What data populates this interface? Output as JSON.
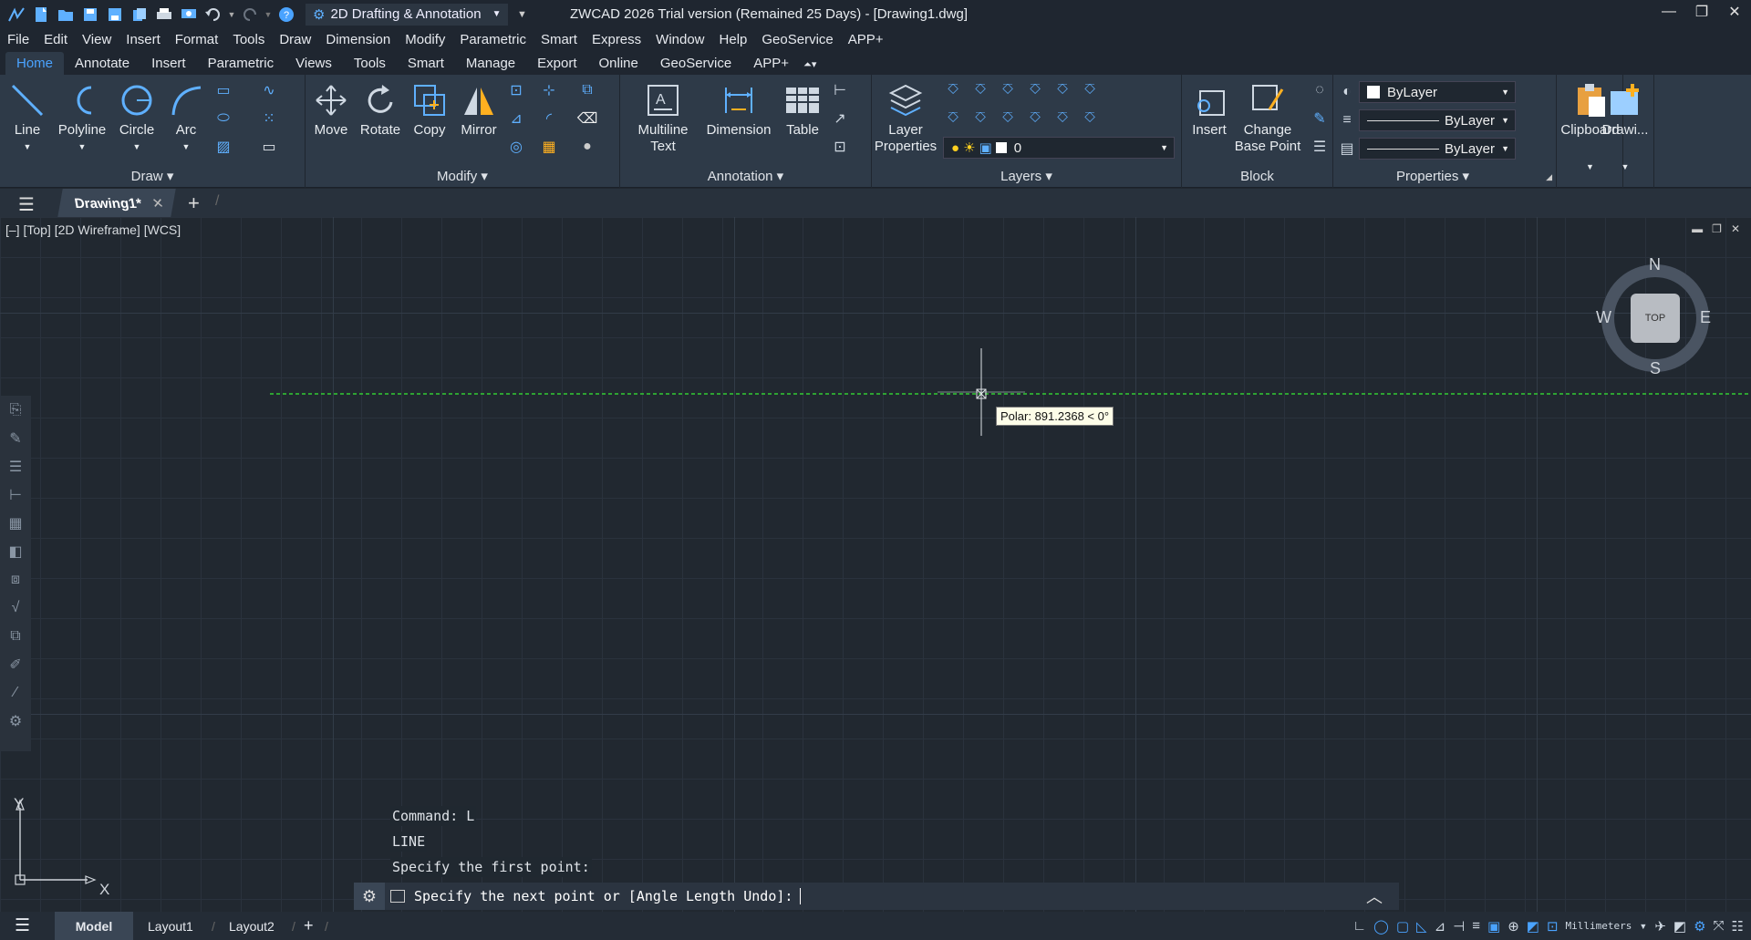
{
  "titlebar": {
    "workspace": "2D Drafting & Annotation",
    "title": "ZWCAD 2026 Trial version (Remained 25 Days) - [Drawing1.dwg]",
    "quick_access_icons": [
      "app-logo-icon",
      "new-icon",
      "open-icon",
      "save-icon",
      "save-as-icon",
      "publish-icon",
      "print-icon",
      "preview-icon",
      "undo-icon",
      "redo-icon",
      "help-icon"
    ]
  },
  "menu": [
    "File",
    "Edit",
    "View",
    "Insert",
    "Format",
    "Tools",
    "Draw",
    "Dimension",
    "Modify",
    "Parametric",
    "Smart",
    "Express",
    "Window",
    "Help",
    "GeoService",
    "APP+"
  ],
  "ribbon_tabs": [
    "Home",
    "Annotate",
    "Insert",
    "Parametric",
    "Views",
    "Tools",
    "Smart",
    "Manage",
    "Export",
    "Online",
    "GeoService",
    "APP+"
  ],
  "ribbon": {
    "draw": {
      "title": "Draw",
      "line": "Line",
      "polyline": "Polyline",
      "circle": "Circle",
      "arc": "Arc"
    },
    "modify": {
      "title": "Modify",
      "move": "Move",
      "rotate": "Rotate",
      "copy": "Copy",
      "mirror": "Mirror"
    },
    "annotation": {
      "title": "Annotation",
      "mtext_1": "Multiline",
      "mtext_2": "Text",
      "dimension": "Dimension",
      "table": "Table"
    },
    "layers": {
      "title": "Layers",
      "props_1": "Layer",
      "props_2": "Properties",
      "current_layer": "0"
    },
    "block": {
      "title": "Block",
      "insert": "Insert",
      "change_1": "Change",
      "change_2": "Base Point"
    },
    "properties": {
      "title": "Properties",
      "color": "ByLayer",
      "linetype": "ByLayer",
      "lineweight": "ByLayer"
    },
    "clipboard": {
      "label": "Clipboard"
    },
    "drawing": {
      "label": "Drawi..."
    }
  },
  "doc_tab": {
    "name": "Drawing1*"
  },
  "viewport": {
    "label": "[–] [Top] [2D Wireframe] [WCS]"
  },
  "viewcube": {
    "n": "N",
    "s": "S",
    "e": "E",
    "w": "W",
    "top": "TOP"
  },
  "tooltip": "Polar: 891.2368 < 0°",
  "ucs": {
    "x": "X",
    "y": "Y"
  },
  "command_history": [
    "Command: L",
    "LINE",
    "Specify the first point:"
  ],
  "command_prompt": "Specify the next point or [Angle Length Undo]:",
  "status": {
    "model": "Model",
    "layout1": "Layout1",
    "layout2": "Layout2",
    "units": "Millimeters"
  },
  "colors": {
    "accent": "#4aa3ff",
    "ribbon_bg": "#2e3a48",
    "canvas_bg": "#212830",
    "rubber_band": "#33cc33"
  }
}
